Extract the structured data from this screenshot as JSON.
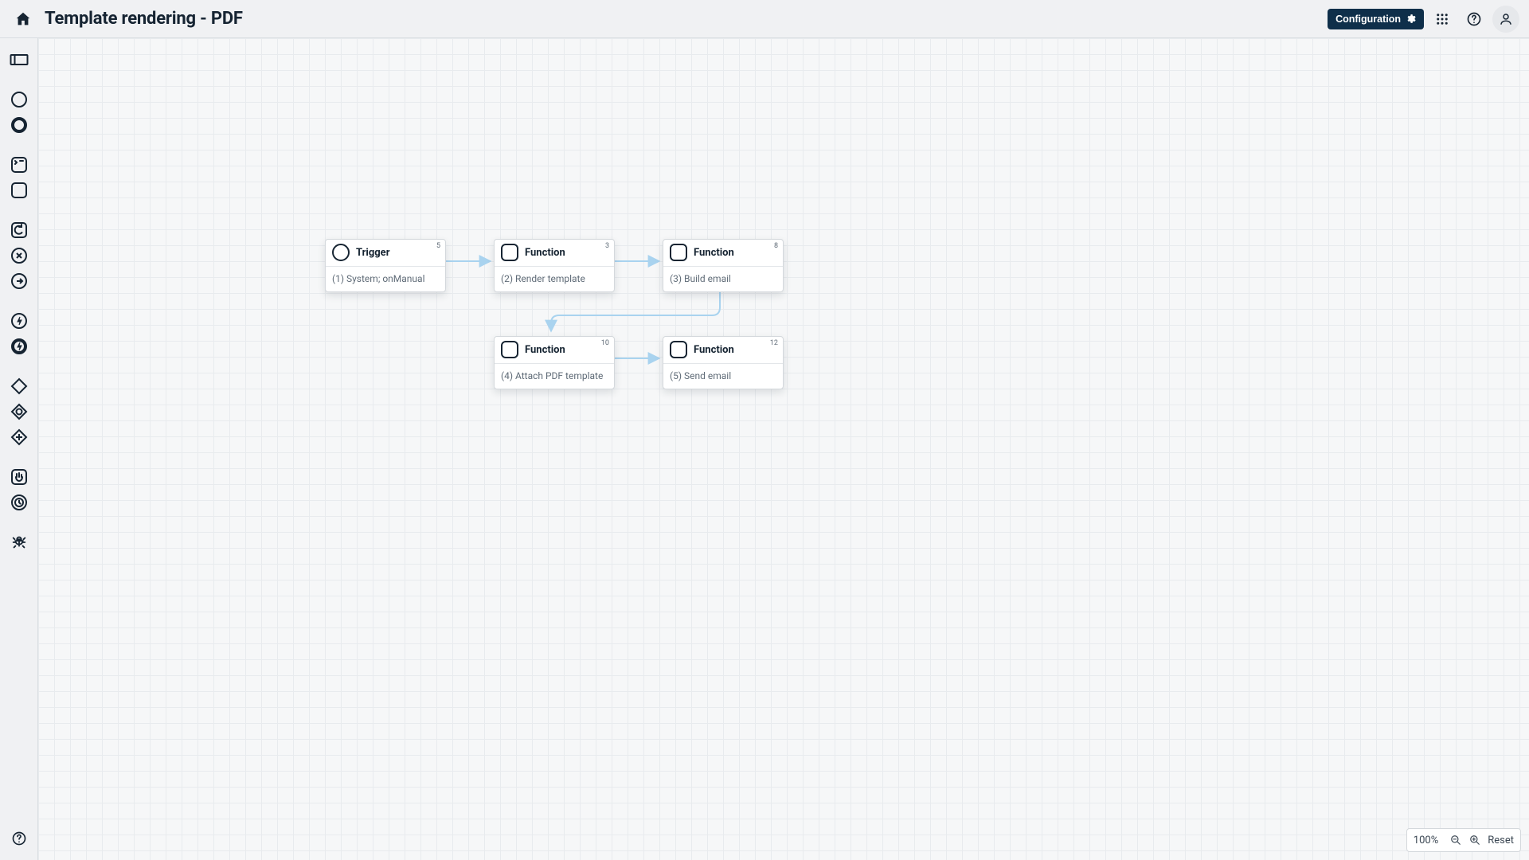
{
  "header": {
    "title": "Template rendering - PDF",
    "config_label": "Configuration"
  },
  "nodes": {
    "n1": {
      "title": "Trigger",
      "desc": "(1) System; onManual",
      "badge": "5"
    },
    "n2": {
      "title": "Function",
      "desc": "(2) Render template",
      "badge": "3"
    },
    "n3": {
      "title": "Function",
      "desc": "(3) Build email",
      "badge": "8"
    },
    "n4": {
      "title": "Function",
      "desc": "(4) Attach PDF template",
      "badge": "10"
    },
    "n5": {
      "title": "Function",
      "desc": "(5) Send email",
      "badge": "12"
    }
  },
  "zoom": {
    "value": "100%",
    "reset_label": "Reset"
  },
  "colors": {
    "arrow": "#a9d3ef",
    "accent_header": "#0f2f4a"
  }
}
